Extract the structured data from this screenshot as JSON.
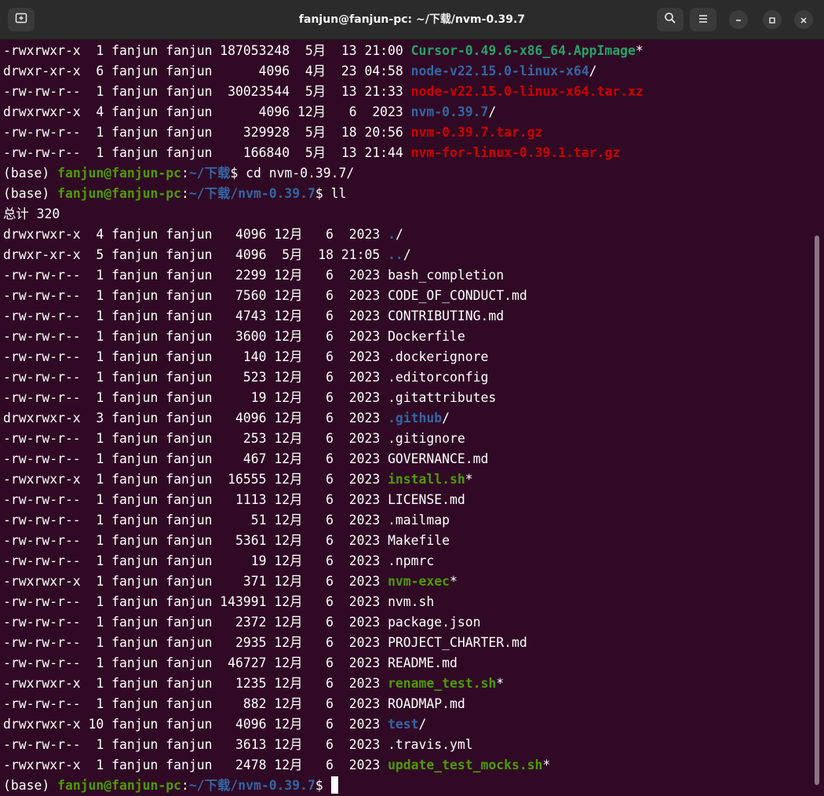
{
  "window": {
    "title": "fanjun@fanjun-pc: ~/下载/nvm-0.39.7",
    "icons": {
      "new_tab": "new-tab-icon",
      "search": "search-icon",
      "menu": "hamburger-menu-icon",
      "minimize": "minimize-icon",
      "maximize": "maximize-icon",
      "close": "close-icon"
    }
  },
  "colors": {
    "background": "#300a24",
    "directory": "#3465a4",
    "executable": "#26a269",
    "archive": "#cc0000",
    "prompt_user": "#4e9a06"
  },
  "top_listing": [
    {
      "meta": "-rwxrwxr-x  1 fanjun fanjun 187053248  5月  13 21:00 ",
      "name": "Cursor-0.49.6-x86_64.AppImage",
      "suffix": "*",
      "kind": "cursor"
    },
    {
      "meta": "drwxr-xr-x  6 fanjun fanjun      4096  4月  23 04:58 ",
      "name": "node-v22.15.0-linux-x64",
      "suffix": "/",
      "kind": "dir"
    },
    {
      "meta": "-rw-rw-r--  1 fanjun fanjun  30023544  5月  13 21:33 ",
      "name": "node-v22.15.0-linux-x64.tar.xz",
      "suffix": "",
      "kind": "arch"
    },
    {
      "meta": "drwxrwxr-x  4 fanjun fanjun      4096 12月   6  2023 ",
      "name": "nvm-0.39.7",
      "suffix": "/",
      "kind": "dir"
    },
    {
      "meta": "-rw-rw-r--  1 fanjun fanjun    329928  5月  18 20:56 ",
      "name": "nvm-0.39.7.tar.gz",
      "suffix": "",
      "kind": "arch"
    },
    {
      "meta": "-rw-rw-r--  1 fanjun fanjun    166840  5月  13 21:44 ",
      "name": "nvm-for-linux-0.39.1.tar.gz",
      "suffix": "",
      "kind": "arch"
    }
  ],
  "prompt1": {
    "base": "(base) ",
    "user": "fanjun@fanjun-pc",
    "colon": ":",
    "path": "~/下载",
    "dollar": "$ ",
    "command": "cd nvm-0.39.7/"
  },
  "prompt2": {
    "base": "(base) ",
    "user": "fanjun@fanjun-pc",
    "colon": ":",
    "path": "~/下载/nvm-0.39.7",
    "dollar": "$ ",
    "command": "ll"
  },
  "total": "总计 320",
  "listing": [
    {
      "meta": "drwxrwxr-x  4 fanjun fanjun   4096 12月   6  2023 ",
      "name": ".",
      "suffix": "/",
      "kind": "dir"
    },
    {
      "meta": "drwxr-xr-x  5 fanjun fanjun   4096  5月  18 21:05 ",
      "name": "..",
      "suffix": "/",
      "kind": "dir"
    },
    {
      "meta": "-rw-rw-r--  1 fanjun fanjun   2299 12月   6  2023 ",
      "name": "bash_completion",
      "suffix": "",
      "kind": "plain"
    },
    {
      "meta": "-rw-rw-r--  1 fanjun fanjun   7560 12月   6  2023 ",
      "name": "CODE_OF_CONDUCT.md",
      "suffix": "",
      "kind": "plain"
    },
    {
      "meta": "-rw-rw-r--  1 fanjun fanjun   4743 12月   6  2023 ",
      "name": "CONTRIBUTING.md",
      "suffix": "",
      "kind": "plain"
    },
    {
      "meta": "-rw-rw-r--  1 fanjun fanjun   3600 12月   6  2023 ",
      "name": "Dockerfile",
      "suffix": "",
      "kind": "plain"
    },
    {
      "meta": "-rw-rw-r--  1 fanjun fanjun    140 12月   6  2023 ",
      "name": ".dockerignore",
      "suffix": "",
      "kind": "plain"
    },
    {
      "meta": "-rw-rw-r--  1 fanjun fanjun    523 12月   6  2023 ",
      "name": ".editorconfig",
      "suffix": "",
      "kind": "plain"
    },
    {
      "meta": "-rw-rw-r--  1 fanjun fanjun     19 12月   6  2023 ",
      "name": ".gitattributes",
      "suffix": "",
      "kind": "plain"
    },
    {
      "meta": "drwxrwxr-x  3 fanjun fanjun   4096 12月   6  2023 ",
      "name": ".github",
      "suffix": "/",
      "kind": "dir"
    },
    {
      "meta": "-rw-rw-r--  1 fanjun fanjun    253 12月   6  2023 ",
      "name": ".gitignore",
      "suffix": "",
      "kind": "plain"
    },
    {
      "meta": "-rw-rw-r--  1 fanjun fanjun    467 12月   6  2023 ",
      "name": "GOVERNANCE.md",
      "suffix": "",
      "kind": "plain"
    },
    {
      "meta": "-rwxrwxr-x  1 fanjun fanjun  16555 12月   6  2023 ",
      "name": "install.sh",
      "suffix": "*",
      "kind": "exec"
    },
    {
      "meta": "-rw-rw-r--  1 fanjun fanjun   1113 12月   6  2023 ",
      "name": "LICENSE.md",
      "suffix": "",
      "kind": "plain"
    },
    {
      "meta": "-rw-rw-r--  1 fanjun fanjun     51 12月   6  2023 ",
      "name": ".mailmap",
      "suffix": "",
      "kind": "plain"
    },
    {
      "meta": "-rw-rw-r--  1 fanjun fanjun   5361 12月   6  2023 ",
      "name": "Makefile",
      "suffix": "",
      "kind": "plain"
    },
    {
      "meta": "-rw-rw-r--  1 fanjun fanjun     19 12月   6  2023 ",
      "name": ".npmrc",
      "suffix": "",
      "kind": "plain"
    },
    {
      "meta": "-rwxrwxr-x  1 fanjun fanjun    371 12月   6  2023 ",
      "name": "nvm-exec",
      "suffix": "*",
      "kind": "exec"
    },
    {
      "meta": "-rw-rw-r--  1 fanjun fanjun 143991 12月   6  2023 ",
      "name": "nvm.sh",
      "suffix": "",
      "kind": "plain"
    },
    {
      "meta": "-rw-rw-r--  1 fanjun fanjun   2372 12月   6  2023 ",
      "name": "package.json",
      "suffix": "",
      "kind": "plain"
    },
    {
      "meta": "-rw-rw-r--  1 fanjun fanjun   2935 12月   6  2023 ",
      "name": "PROJECT_CHARTER.md",
      "suffix": "",
      "kind": "plain"
    },
    {
      "meta": "-rw-rw-r--  1 fanjun fanjun  46727 12月   6  2023 ",
      "name": "README.md",
      "suffix": "",
      "kind": "plain"
    },
    {
      "meta": "-rwxrwxr-x  1 fanjun fanjun   1235 12月   6  2023 ",
      "name": "rename_test.sh",
      "suffix": "*",
      "kind": "exec"
    },
    {
      "meta": "-rw-rw-r--  1 fanjun fanjun    882 12月   6  2023 ",
      "name": "ROADMAP.md",
      "suffix": "",
      "kind": "plain"
    },
    {
      "meta": "drwxrwxr-x 10 fanjun fanjun   4096 12月   6  2023 ",
      "name": "test",
      "suffix": "/",
      "kind": "dir"
    },
    {
      "meta": "-rw-rw-r--  1 fanjun fanjun   3613 12月   6  2023 ",
      "name": ".travis.yml",
      "suffix": "",
      "kind": "plain"
    },
    {
      "meta": "-rwxrwxr-x  1 fanjun fanjun   2478 12月   6  2023 ",
      "name": "update_test_mocks.sh",
      "suffix": "*",
      "kind": "exec"
    }
  ],
  "prompt3": {
    "base": "(base) ",
    "user": "fanjun@fanjun-pc",
    "colon": ":",
    "path": "~/下载/nvm-0.39.7",
    "dollar": "$ ",
    "command": ""
  }
}
